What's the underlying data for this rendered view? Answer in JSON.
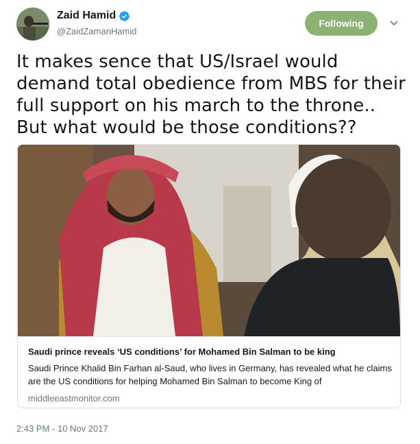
{
  "author": {
    "name": "Zaid Hamid",
    "handle": "@ZaidZamanHamid"
  },
  "follow_button": {
    "label": "Following"
  },
  "tweet": {
    "text": "It makes sence that US/Israel would demand total obedience from MBS for their full support on his march to the throne..\nBut what would be those conditions??",
    "timestamp": "2:43 PM - 10 Nov 2017"
  },
  "card": {
    "title": "Saudi prince reveals ‘US conditions’ for Mohamed Bin Salman to be king",
    "description": "Saudi Prince Khalid Bin Farhan al-Saud, who lives in Germany, has revealed what he claims are the US conditions for helping Mohamed Bin Salman to become King of",
    "domain": "middleeastmonitor.com"
  },
  "colors": {
    "follow_button_bg": "#8bb173",
    "verified_badge": "#1da1f2",
    "secondary_text": "#657786"
  },
  "icons": [
    "verified-badge-icon",
    "chevron-down-icon"
  ]
}
